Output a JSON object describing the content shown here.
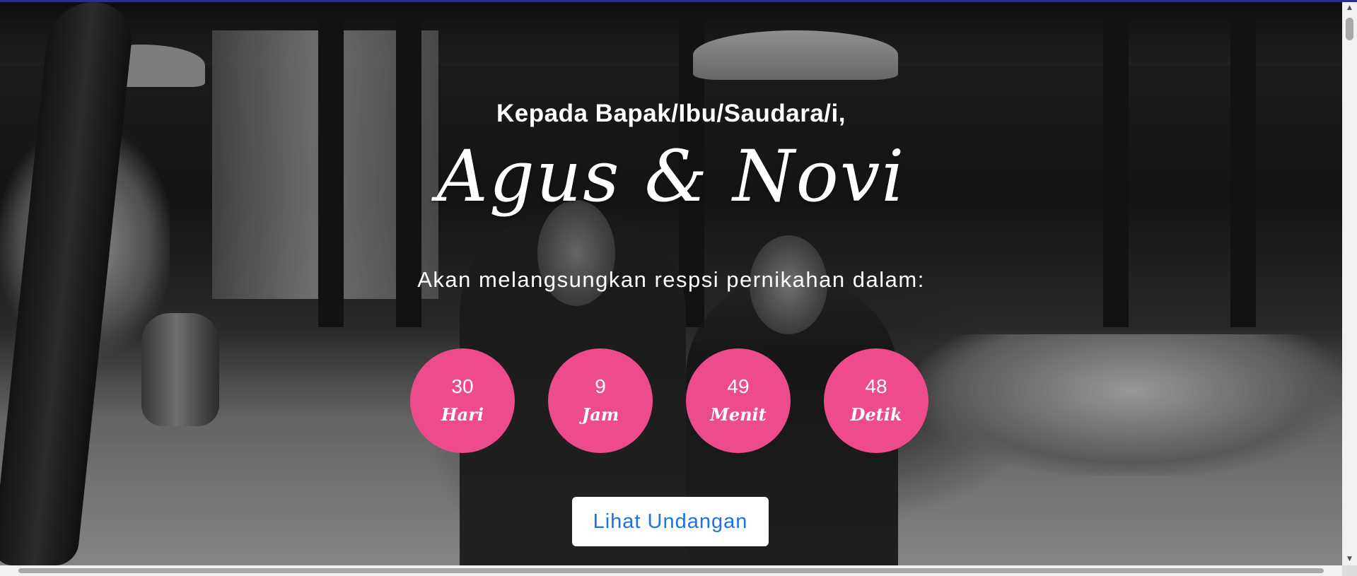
{
  "invitation": {
    "greeting": "Kepada Bapak/Ibu/Saudara/i,",
    "couple_names": "Agus & Novi",
    "subtitle": "Akan melangsungkan respsi pernikahan dalam:"
  },
  "countdown": [
    {
      "value": "30",
      "unit": "Hari"
    },
    {
      "value": "9",
      "unit": "Jam"
    },
    {
      "value": "49",
      "unit": "Menit"
    },
    {
      "value": "48",
      "unit": "Detik"
    }
  ],
  "cta": {
    "label": "Lihat Undangan"
  },
  "colors": {
    "accent_pink": "#ee4b8d",
    "button_text": "#1a73e8",
    "top_bar": "#2b2f8f"
  },
  "icons": {
    "scroll_up": "triangle-up-icon",
    "scroll_down": "triangle-down-icon"
  }
}
